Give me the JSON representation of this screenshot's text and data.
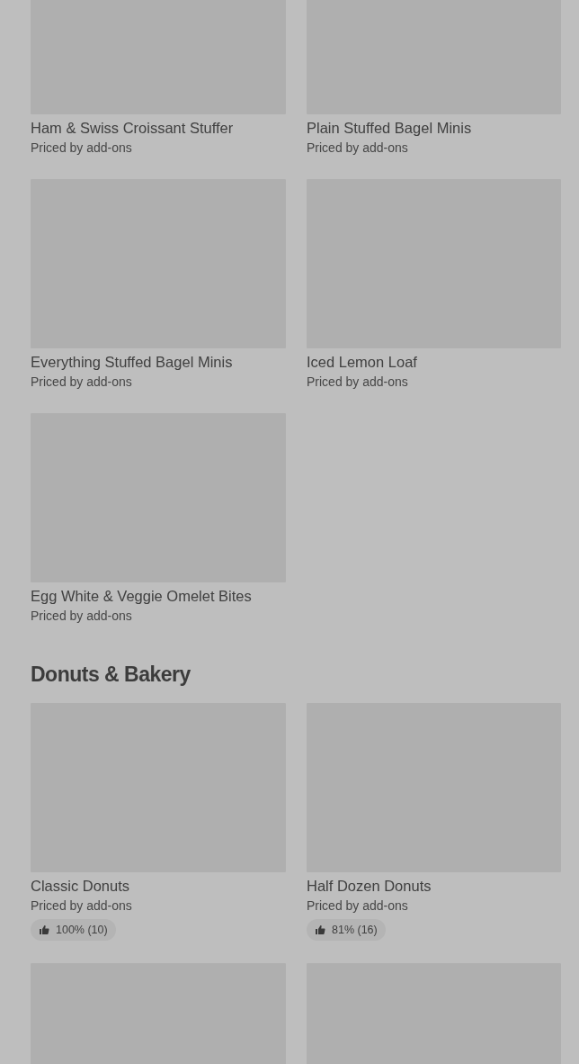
{
  "sections": [
    {
      "items": [
        {
          "image": true,
          "title": "Ham & Swiss Croissant Stuffer",
          "price": "Priced by add-ons"
        },
        {
          "image": true,
          "title": "Plain Stuffed Bagel Minis",
          "price": "Priced by add-ons"
        },
        {
          "image": true,
          "title": "Everything Stuffed Bagel Minis",
          "price": "Priced by add-ons"
        },
        {
          "image": true,
          "title": "Iced Lemon Loaf",
          "price": "Priced by add-ons"
        },
        {
          "image": true,
          "title": "Egg White & Veggie Omelet Bites",
          "price": "Priced by add-ons"
        }
      ]
    },
    {
      "heading": "Donuts & Bakery",
      "items": [
        {
          "image": true,
          "title": "Classic Donuts",
          "price": "Priced by add-ons",
          "rating": "100% (10)"
        },
        {
          "image": true,
          "title": "Half Dozen Donuts",
          "price": "Priced by add-ons",
          "rating": "81% (16)"
        },
        {
          "image": true
        },
        {
          "image": true
        }
      ]
    }
  ]
}
